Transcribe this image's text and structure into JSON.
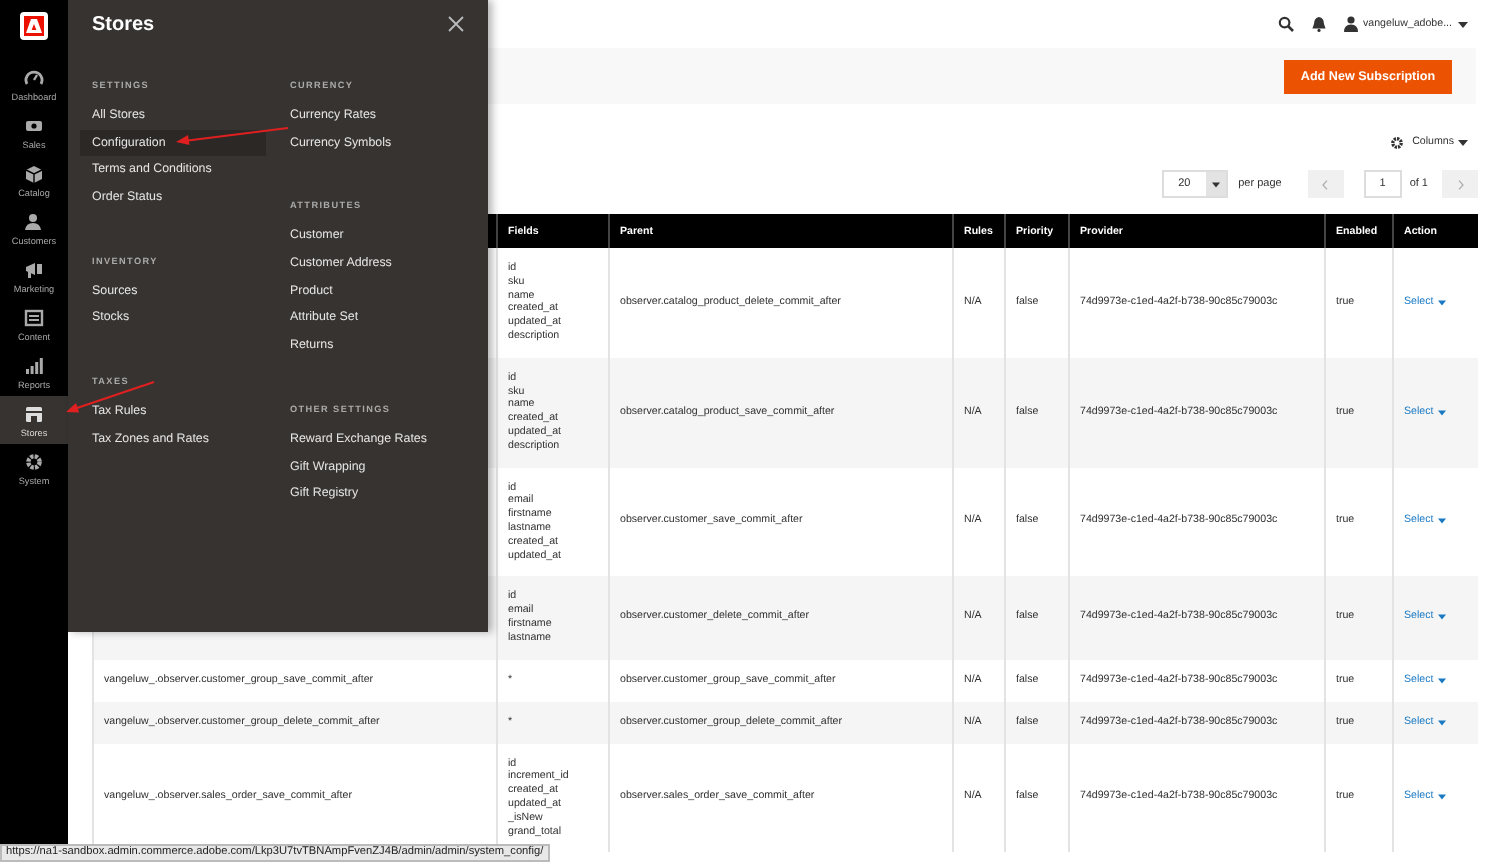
{
  "nav": {
    "items": [
      {
        "label": "Dashboard",
        "selected": false
      },
      {
        "label": "Sales",
        "selected": false
      },
      {
        "label": "Catalog",
        "selected": false
      },
      {
        "label": "Customers",
        "selected": false
      },
      {
        "label": "Marketing",
        "selected": false
      },
      {
        "label": "Content",
        "selected": false
      },
      {
        "label": "Reports",
        "selected": false
      },
      {
        "label": "Stores",
        "selected": true
      },
      {
        "label": "System",
        "selected": false
      }
    ]
  },
  "header": {
    "user": "vangeluw_adobe..."
  },
  "page_actions": {
    "primary_button": "Add New Subscription"
  },
  "grid_toolbar": {
    "columns_label": "Columns",
    "per_page": "20",
    "per_page_label": "per page",
    "page": "1",
    "page_total": "of 1"
  },
  "table": {
    "columns": [
      "Fields",
      "Parent",
      "Rules",
      "Priority",
      "Provider",
      "Enabled",
      "Action"
    ],
    "rows": [
      {
        "fields": [
          "id",
          "sku",
          "name",
          "created_at",
          "updated_at",
          "description"
        ],
        "parent": "observer.catalog_product_delete_commit_after",
        "rules": "N/A",
        "priority": "false",
        "provider": "74d9973e-c1ed-4a2f-b738-90c85c79003c",
        "enabled": "true",
        "action": "Select"
      },
      {
        "fields": [
          "id",
          "sku",
          "name",
          "created_at",
          "updated_at",
          "description"
        ],
        "parent": "observer.catalog_product_save_commit_after",
        "rules": "N/A",
        "priority": "false",
        "provider": "74d9973e-c1ed-4a2f-b738-90c85c79003c",
        "enabled": "true",
        "action": "Select"
      },
      {
        "fields": [
          "id",
          "email",
          "firstname",
          "lastname",
          "created_at",
          "updated_at"
        ],
        "parent": "observer.customer_save_commit_after",
        "rules": "N/A",
        "priority": "false",
        "provider": "74d9973e-c1ed-4a2f-b738-90c85c79003c",
        "enabled": "true",
        "action": "Select"
      },
      {
        "fields": [
          "id",
          "email",
          "firstname",
          "lastname"
        ],
        "parent": "observer.customer_delete_commit_after",
        "rules": "N/A",
        "priority": "false",
        "provider": "74d9973e-c1ed-4a2f-b738-90c85c79003c",
        "enabled": "true",
        "action": "Select"
      },
      {
        "name": "vangeluw_.observer.customer_group_save_commit_after",
        "fields": [
          "*"
        ],
        "parent": "observer.customer_group_save_commit_after",
        "rules": "N/A",
        "priority": "false",
        "provider": "74d9973e-c1ed-4a2f-b738-90c85c79003c",
        "enabled": "true",
        "action": "Select"
      },
      {
        "name": "vangeluw_.observer.customer_group_delete_commit_after",
        "fields": [
          "*"
        ],
        "parent": "observer.customer_group_delete_commit_after",
        "rules": "N/A",
        "priority": "false",
        "provider": "74d9973e-c1ed-4a2f-b738-90c85c79003c",
        "enabled": "true",
        "action": "Select"
      },
      {
        "name": "vangeluw_.observer.sales_order_save_commit_after",
        "fields": [
          "id",
          "increment_id",
          "created_at",
          "updated_at",
          "_isNew",
          "grand_total"
        ],
        "parent": "observer.sales_order_save_commit_after",
        "rules": "N/A",
        "priority": "false",
        "provider": "74d9973e-c1ed-4a2f-b738-90c85c79003c",
        "enabled": "true",
        "action": "Select"
      }
    ]
  },
  "flyout": {
    "title": "Stores",
    "columns": [
      [
        {
          "heading": "SETTINGS",
          "items": [
            {
              "label": "All Stores",
              "selected": false
            },
            {
              "label": "Configuration",
              "selected": true
            },
            {
              "label": "Terms and Conditions",
              "selected": false
            },
            {
              "label": "Order Status",
              "selected": false
            }
          ]
        },
        {
          "heading": "INVENTORY",
          "items": [
            {
              "label": "Sources",
              "selected": false
            },
            {
              "label": "Stocks",
              "selected": false
            }
          ]
        },
        {
          "heading": "TAXES",
          "items": [
            {
              "label": "Tax Rules",
              "selected": false
            },
            {
              "label": "Tax Zones and Rates",
              "selected": false
            }
          ]
        }
      ],
      [
        {
          "heading": "CURRENCY",
          "items": [
            {
              "label": "Currency Rates",
              "selected": false
            },
            {
              "label": "Currency Symbols",
              "selected": false
            }
          ]
        },
        {
          "heading": "ATTRIBUTES",
          "items": [
            {
              "label": "Customer",
              "selected": false
            },
            {
              "label": "Customer Address",
              "selected": false
            },
            {
              "label": "Product",
              "selected": false
            },
            {
              "label": "Attribute Set",
              "selected": false
            },
            {
              "label": "Returns",
              "selected": false
            }
          ]
        },
        {
          "heading": "OTHER SETTINGS",
          "items": [
            {
              "label": "Reward Exchange Rates",
              "selected": false
            },
            {
              "label": "Gift Wrapping",
              "selected": false
            },
            {
              "label": "Gift Registry",
              "selected": false
            }
          ]
        }
      ]
    ]
  },
  "status_bar": {
    "url": "https://na1-sandbox.admin.commerce.adobe.com/Lkp3U7tvTBNAmpFvenZJ4B/admin/admin/system_config/"
  }
}
